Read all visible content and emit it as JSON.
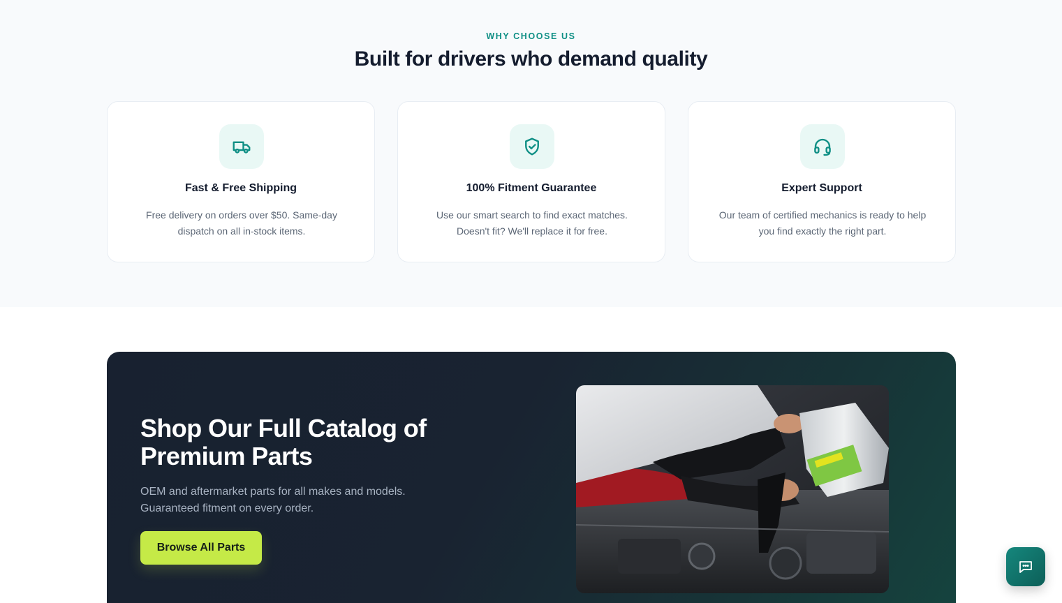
{
  "why": {
    "eyebrow": "WHY CHOOSE US",
    "headline": "Built for drivers who demand quality",
    "features": [
      {
        "icon": "truck-icon",
        "title": "Fast & Free Shipping",
        "description": "Free delivery on orders over $50. Same-day dispatch on all in-stock items."
      },
      {
        "icon": "shield-check-icon",
        "title": "100% Fitment Guarantee",
        "description": "Use our smart search to find exact matches. Doesn't fit? We'll replace it for free."
      },
      {
        "icon": "headset-icon",
        "title": "Expert Support",
        "description": "Our team of certified mechanics is ready to help you find exactly the right part."
      }
    ]
  },
  "cta": {
    "title": "Shop Our Full Catalog of Premium Parts",
    "subtitle": "OEM and aftermarket parts for all makes and models. Guaranteed fitment on every order.",
    "button_label": "Browse All Parts",
    "image_description": "Mechanic pouring motor oil into car engine"
  },
  "chat": {
    "icon": "chat-icon"
  },
  "colors": {
    "accent": "#0f8f85",
    "icon_bg": "#e9f8f5",
    "cta_button": "#c5ea47",
    "dark_bg": "#182130"
  }
}
